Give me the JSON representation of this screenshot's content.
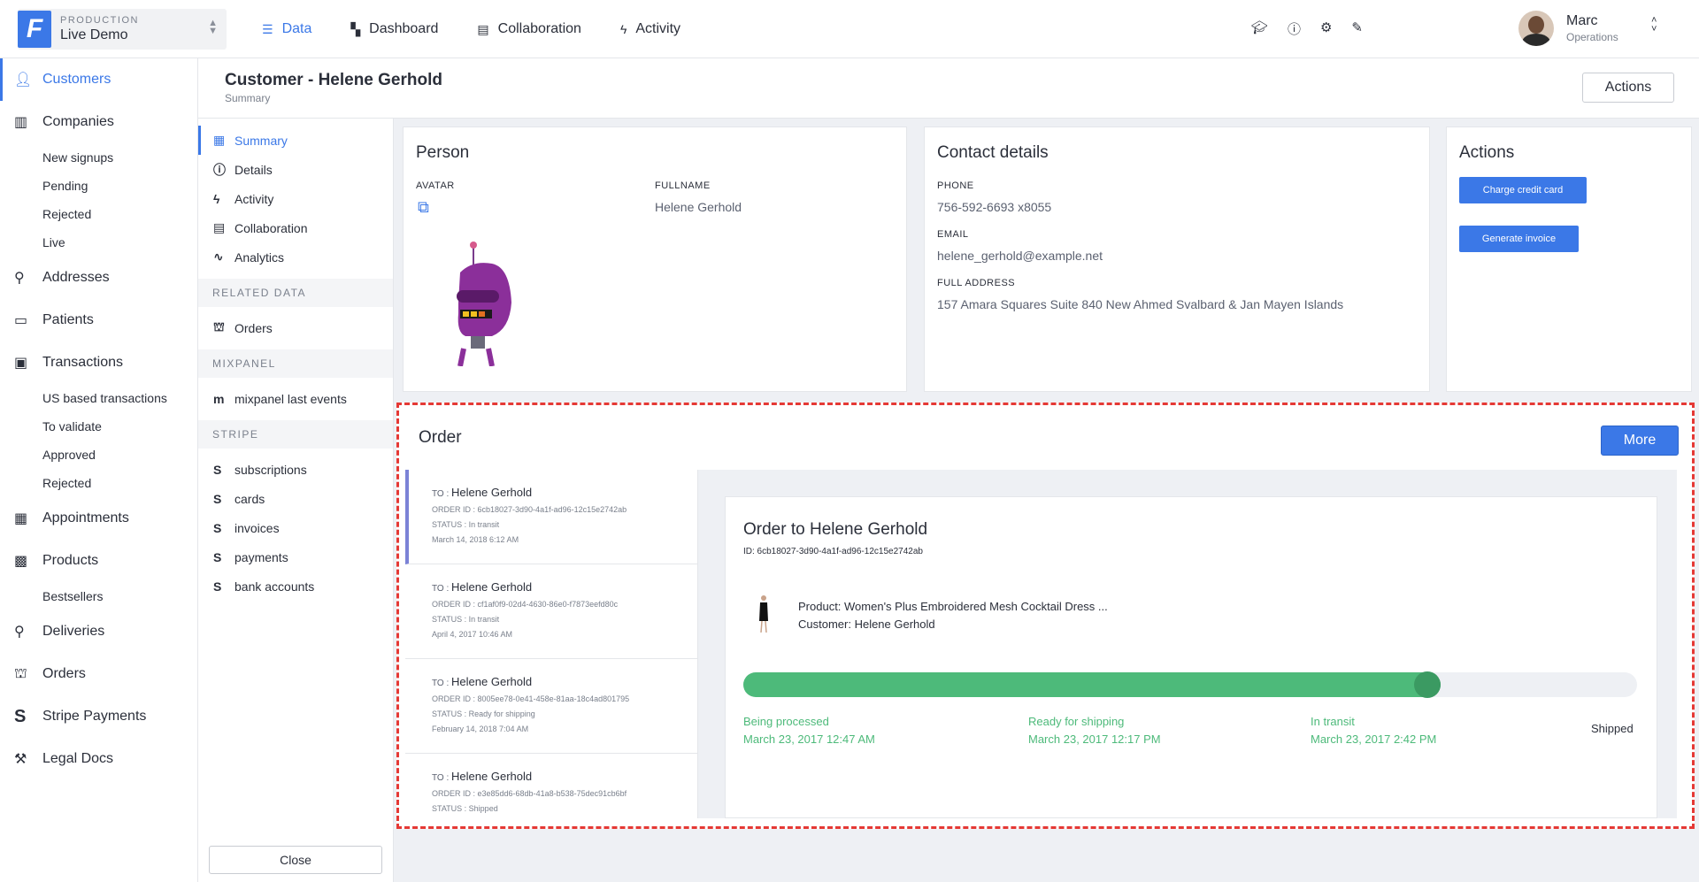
{
  "env": {
    "label": "PRODUCTION",
    "name": "Live Demo",
    "logo": "F"
  },
  "nav": [
    {
      "label": "Data",
      "icon": "list-icon",
      "active": true
    },
    {
      "label": "Dashboard",
      "icon": "dashboard-icon",
      "active": false
    },
    {
      "label": "Collaboration",
      "icon": "chat-icon",
      "active": false
    },
    {
      "label": "Activity",
      "icon": "bolt-icon",
      "active": false
    }
  ],
  "user": {
    "name": "Marc",
    "role": "Operations"
  },
  "sidebar": {
    "items": [
      {
        "label": "Customers",
        "icon": "person-icon",
        "active": true
      },
      {
        "label": "Companies",
        "icon": "building-icon"
      },
      {
        "label": "New signups",
        "sub": true
      },
      {
        "label": "Pending",
        "sub": true
      },
      {
        "label": "Rejected",
        "sub": true
      },
      {
        "label": "Live",
        "sub": true
      },
      {
        "label": "Addresses",
        "icon": "pin-icon"
      },
      {
        "label": "Patients",
        "icon": "id-card-icon"
      },
      {
        "label": "Transactions",
        "icon": "money-icon"
      },
      {
        "label": "US based transactions",
        "sub": true
      },
      {
        "label": "To validate",
        "sub": true
      },
      {
        "label": "Approved",
        "sub": true
      },
      {
        "label": "Rejected",
        "sub": true
      },
      {
        "label": "Appointments",
        "icon": "calendar-icon"
      },
      {
        "label": "Products",
        "icon": "archive-icon"
      },
      {
        "label": "Bestsellers",
        "sub": true
      },
      {
        "label": "Deliveries",
        "icon": "pin-icon"
      },
      {
        "label": "Orders",
        "icon": "basket-icon"
      },
      {
        "label": "Stripe Payments",
        "icon": "stripe-icon"
      },
      {
        "label": "Legal Docs",
        "icon": "gavel-icon"
      }
    ]
  },
  "header": {
    "title": "Customer - Helene Gerhold",
    "subtitle": "Summary",
    "actions_label": "Actions"
  },
  "subnav": {
    "main": [
      {
        "label": "Summary",
        "active": true
      },
      {
        "label": "Details"
      },
      {
        "label": "Activity"
      },
      {
        "label": "Collaboration"
      },
      {
        "label": "Analytics"
      }
    ],
    "related_title": "RELATED DATA",
    "related": [
      {
        "label": "Orders"
      }
    ],
    "mixpanel_title": "MIXPANEL",
    "mixpanel": [
      {
        "label": "mixpanel last events"
      }
    ],
    "stripe_title": "STRIPE",
    "stripe": [
      {
        "label": "subscriptions"
      },
      {
        "label": "cards"
      },
      {
        "label": "invoices"
      },
      {
        "label": "payments"
      },
      {
        "label": "bank accounts"
      }
    ],
    "close_label": "Close"
  },
  "person": {
    "title": "Person",
    "avatar_label": "AVATAR",
    "fullname_label": "FULLNAME",
    "fullname": "Helene Gerhold"
  },
  "contact": {
    "title": "Contact details",
    "phone_label": "PHONE",
    "phone": "756-592-6693 x8055",
    "email_label": "EMAIL",
    "email": "helene_gerhold@example.net",
    "address_label": "FULL ADDRESS",
    "address": "157 Amara Squares Suite 840 New Ahmed Svalbard & Jan Mayen Islands"
  },
  "actions_card": {
    "title": "Actions",
    "charge_label": "Charge credit card",
    "invoice_label": "Generate invoice"
  },
  "order": {
    "title": "Order",
    "more_label": "More",
    "list": [
      {
        "to_label": "TO :",
        "to": "Helene Gerhold",
        "order_id": "ORDER ID : 6cb18027-3d90-4a1f-ad96-12c15e2742ab",
        "status": "STATUS : In transit",
        "date": "March 14, 2018 6:12 AM"
      },
      {
        "to_label": "TO :",
        "to": "Helene Gerhold",
        "order_id": "ORDER ID : cf1af0f9-02d4-4630-86e0-f7873eefd80c",
        "status": "STATUS : In transit",
        "date": "April 4, 2017 10:46 AM"
      },
      {
        "to_label": "TO :",
        "to": "Helene Gerhold",
        "order_id": "ORDER ID : 8005ee78-0e41-458e-81aa-18c4ad801795",
        "status": "STATUS : Ready for shipping",
        "date": "February 14, 2018 7:04 AM"
      },
      {
        "to_label": "TO :",
        "to": "Helene Gerhold",
        "order_id": "ORDER ID : e3e85dd6-68db-41a8-b538-75dec91cb6bf",
        "status": "STATUS : Shipped",
        "date": ""
      }
    ],
    "detail": {
      "title": "Order to Helene Gerhold",
      "id": "ID: 6cb18027-3d90-4a1f-ad96-12c15e2742ab",
      "product": "Product: Women's Plus Embroidered Mesh Cocktail Dress ...",
      "customer": "Customer: Helene Gerhold",
      "progress": 0.78,
      "steps": [
        {
          "label": "Being processed",
          "date": "March 23, 2017 12:47 AM"
        },
        {
          "label": "Ready for shipping",
          "date": "March 23, 2017 12:17 PM"
        },
        {
          "label": "In transit",
          "date": "March 23, 2017 2:42 PM"
        },
        {
          "label": "Shipped",
          "date": ""
        }
      ]
    }
  },
  "colors": {
    "accent": "#3b78e7",
    "success": "#4dba7a",
    "highlight": "#e53935"
  }
}
